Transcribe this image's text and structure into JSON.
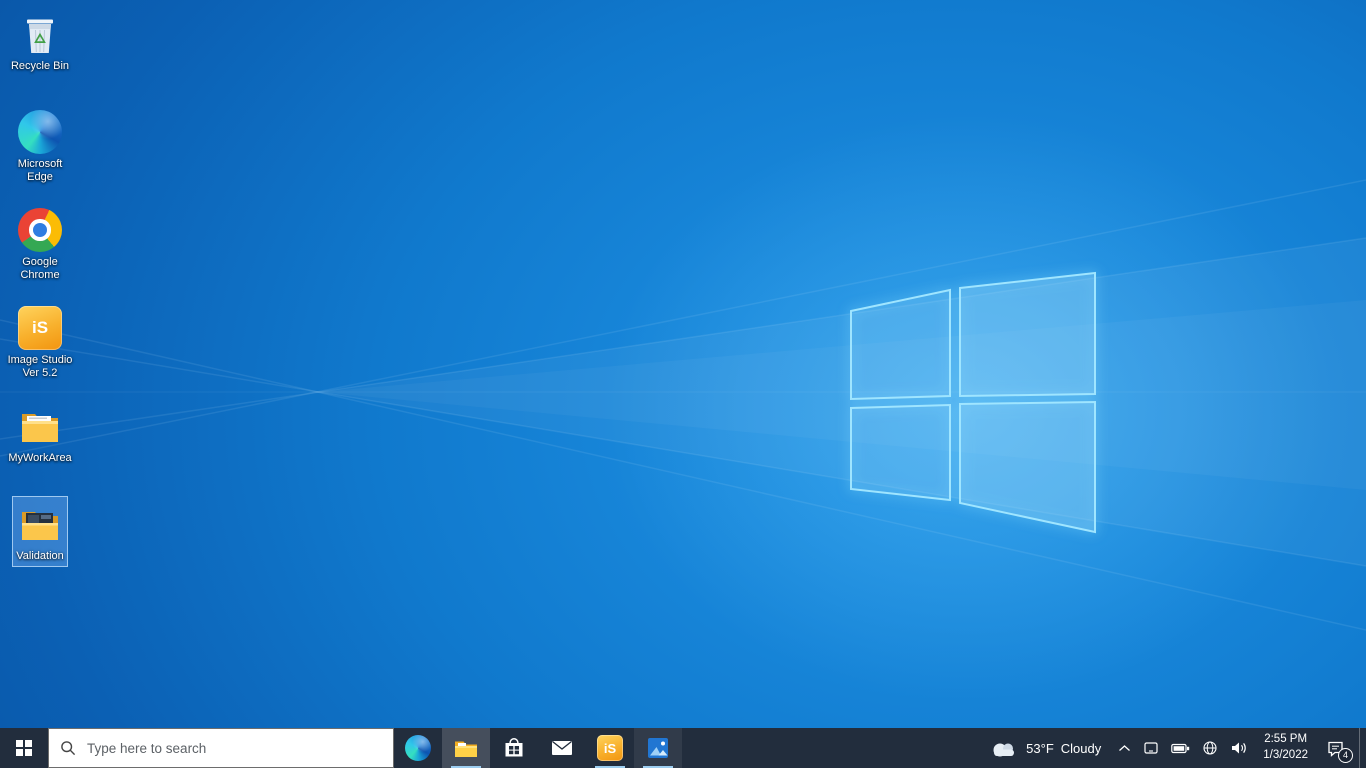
{
  "desktop": {
    "icons": [
      {
        "id": "recycle-bin",
        "label": "Recycle Bin",
        "selected": false
      },
      {
        "id": "microsoft-edge",
        "label": "Microsoft Edge",
        "selected": false
      },
      {
        "id": "google-chrome",
        "label": "Google Chrome",
        "selected": false
      },
      {
        "id": "image-studio",
        "label": "Image Studio Ver 5.2",
        "glyph": "iS",
        "selected": false
      },
      {
        "id": "myworkarea",
        "label": "MyWorkArea",
        "selected": false
      },
      {
        "id": "validation",
        "label": "Validation",
        "selected": true
      }
    ]
  },
  "taskbar": {
    "search": {
      "placeholder": "Type here to search",
      "icon": "search-icon"
    },
    "apps": [
      {
        "id": "edge",
        "icon": "edge-icon",
        "running": false
      },
      {
        "id": "file-explorer",
        "icon": "file-explorer-icon",
        "running": true,
        "active": true
      },
      {
        "id": "store",
        "icon": "store-icon",
        "running": false
      },
      {
        "id": "mail",
        "icon": "mail-icon",
        "running": false
      },
      {
        "id": "image-studio",
        "icon": "image-studio-icon",
        "glyph": "iS",
        "running": true
      },
      {
        "id": "photos",
        "icon": "photos-icon",
        "running": true
      }
    ],
    "tray": {
      "weather": {
        "temp": "53°F",
        "condition": "Cloudy",
        "icon": "cloud-icon"
      },
      "icons": [
        "chevron-up-icon",
        "tablet-icon",
        "battery-icon",
        "network-icon",
        "volume-icon"
      ],
      "clock": {
        "time": "2:55 PM",
        "date": "1/3/2022"
      },
      "notifications": {
        "badge": "4",
        "icon": "action-center-icon"
      }
    }
  },
  "colors": {
    "taskbar_bg": "#222d3d",
    "running_indicator": "#9ccdf0",
    "selection_fill": "rgba(140,190,255,0.33)",
    "wallpaper_base": "#1079cd",
    "window_logo_stroke": "#9fe5ff"
  }
}
